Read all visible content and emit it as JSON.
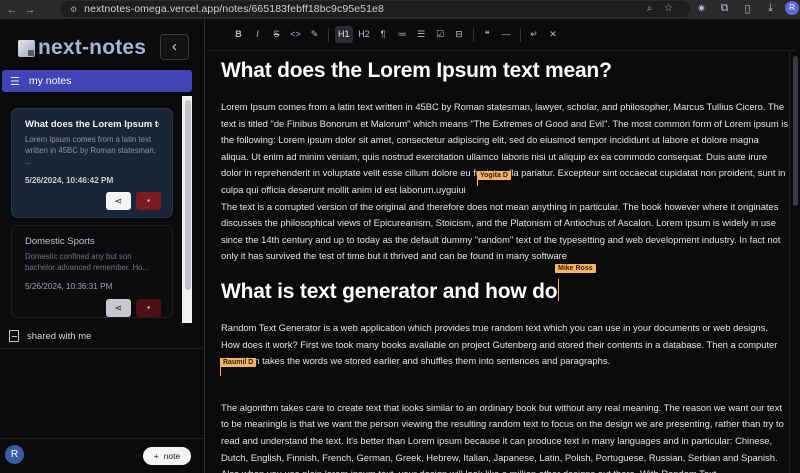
{
  "browser": {
    "url": "nextnotes-omega.vercel.app/notes/665183febff18bc9c95e51e8",
    "profile_initial": "R",
    "icons": [
      "back-arrow-icon",
      "forward-arrow-icon",
      "site-info-icon",
      "zoom-icon",
      "bookmark-star-icon",
      "extension-icon",
      "puzzle-icon",
      "download-icon",
      "profile-avatar",
      "menu-kebab-icon"
    ]
  },
  "sidebar": {
    "app_name": "next-notes",
    "collapse_glyph": "‹",
    "my_notes_label": "my notes",
    "notes": [
      {
        "title": "What does the Lorem Ipsum te...",
        "snippet": "Lorem Ipsum comes from a latin text written in 45BC by Roman statesman, ...",
        "date": "5/26/2024, 10:46:42 PM",
        "active": true
      },
      {
        "title": "Domestic Sports",
        "snippet": "Domestic confined any but son bachelor advanced remember. Ho...",
        "date": "5/26/2024, 10:36:31 PM",
        "active": false
      }
    ],
    "shared_label": "shared with me",
    "user_initial": "R",
    "add_note_label": "note",
    "add_note_glyph": "+"
  },
  "toolbar": {
    "buttons": [
      {
        "name": "bold-button",
        "glyph": "B"
      },
      {
        "name": "italic-button",
        "glyph": "I"
      },
      {
        "name": "strike-button",
        "glyph": "S"
      },
      {
        "name": "code-button",
        "glyph": "<>"
      },
      {
        "name": "highlight-button",
        "glyph": "✎"
      },
      {
        "name": "heading1-button",
        "glyph": "H1"
      },
      {
        "name": "heading2-button",
        "glyph": "H2"
      },
      {
        "name": "paragraph-button",
        "glyph": "¶"
      },
      {
        "name": "bullet-list-button",
        "glyph": "≔"
      },
      {
        "name": "ordered-list-button",
        "glyph": "☰"
      },
      {
        "name": "task-list-button",
        "glyph": "☑"
      },
      {
        "name": "code-block-button",
        "glyph": "⊟"
      },
      {
        "name": "blockquote-button",
        "glyph": "❝"
      },
      {
        "name": "horizontal-rule-button",
        "glyph": "—"
      },
      {
        "name": "hard-break-button",
        "glyph": "↵"
      },
      {
        "name": "clear-format-button",
        "glyph": "✕"
      }
    ]
  },
  "document": {
    "heading_1": "What does the Lorem Ipsum text mean?",
    "paragraph_1": "Lorem Ipsum comes from a latin text written in 45BC by Roman statesman, lawyer, scholar, and philosopher, Marcus Tullius Cicero. The text is titled \"de Finibus Bonorum et Malorum\" which means \"The Extremes of Good and Evil\". The most common form of Lorem ipsum is the following: Lorem ipsum dolor sit amet, consectetur adipiscing elit, sed do eiusmod tempor incididunt ut labore et dolore magna aliqua. Ut enim ad minim veniam, quis nostrud exercitation ullamco laboris nisi ut aliquip ex ea commodo consequat. Duis aute irure dolor in reprehenderit in voluptate velit esse cillum dolore eu fugiat nulla pariatur. Excepteur sint occaecat cupidatat non proident, sunt in culpa qui officia deserunt mollit anim id est laborum.uyguiui",
    "paragraph_2": "The text is a corrupted version of the original and therefore does not mean anything in particular. The book however where it originates discusses the philosophical views of Epicureanism, Stoicism, and the Platonism of Antiochus of Ascalon. Lorem ipsum is widely in use since the 14th century and up to today as the default dummy \"random\" text of the typesetting and web development industry. In fact not only it has survived the test of time but it thrived and can be found in many software",
    "heading_2": "What is text generator and how do",
    "paragraph_3": "Random Text Generator is a web application which provides true random text which you can use in your documents or web designs. How does it work? First we took many books available on project Gutenberg and stored their contents in a database. Then a computer algorithm takes the words we stored earlier and shuffles them into sentences and paragraphs.",
    "paragraph_4": "The algorithm takes care to create text that looks similar to an ordinary book but without any real meaning. The reason we want our text to be meaningls is that we want the person viewing the resulting random text to focus on the design we are presenting, rather than try to read and understand the text. It's better than Lorem ipsum because it can produce text in many languages and in particular: Chinese, Dutch, English, Finnish, French, German, Greek, Hebrew, Italian, Japanese, Latin, Polish, Portuguese, Russian, Serbian and Spanish. Also when you use plain lorem ipsum text, your design will look like a million other designs out there. With Random Text"
  },
  "collaborators": [
    {
      "name": "Yogita D",
      "color": "#f2b46a"
    },
    {
      "name": "Mike Ross",
      "color": "#f2b46a"
    },
    {
      "name": "Raumil D",
      "color": "#f2b46a"
    }
  ]
}
